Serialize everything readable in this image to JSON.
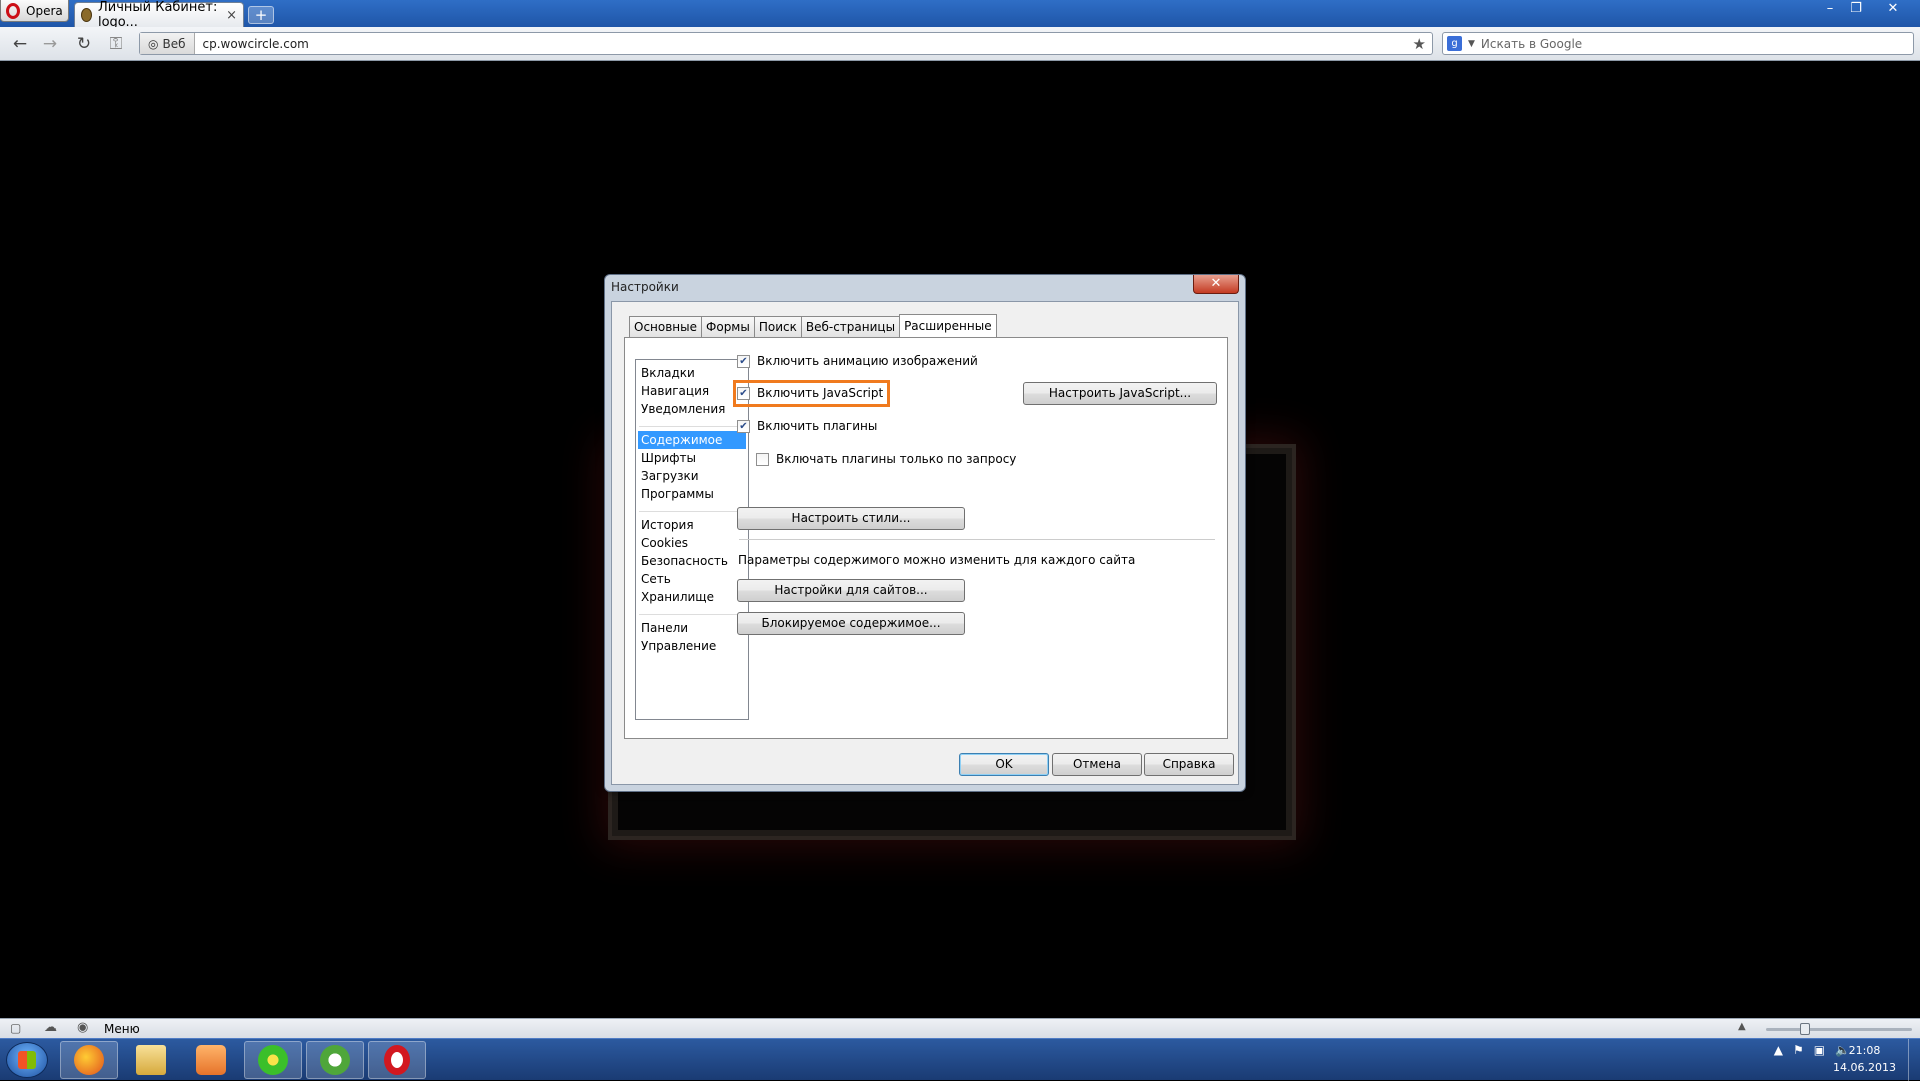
{
  "browser": {
    "menu_button": "Opera",
    "tab_title": "Личный Кабинет: logo...",
    "tab_close": "×",
    "new_tab": "+",
    "window_controls": [
      "–",
      "❐",
      "✕"
    ],
    "address_badge": "Веб",
    "address_url": "cp.wowcircle.com",
    "search_placeholder": "Искать в Google",
    "search_engine_letter": "g"
  },
  "dialog": {
    "title": "Настройки",
    "close": "✕",
    "tabs": [
      "Основные",
      "Формы",
      "Поиск",
      "Веб-страницы",
      "Расширенные"
    ],
    "active_tab": "Расширенные",
    "sidebar": {
      "group1": [
        "Вкладки",
        "Навигация",
        "Уведомления"
      ],
      "group2": [
        "Содержимое",
        "Шрифты",
        "Загрузки",
        "Программы"
      ],
      "group3": [
        "История",
        "Cookies",
        "Безопасность",
        "Сеть",
        "Хранилище"
      ],
      "group4": [
        "Панели",
        "Управление"
      ],
      "selected": "Содержимое"
    },
    "options": {
      "animation": {
        "label": "Включить анимацию изображений",
        "checked": true
      },
      "javascript": {
        "label": "Включить JavaScript",
        "checked": true
      },
      "plugins": {
        "label": "Включить плагины",
        "checked": true
      },
      "plugins_on_demand": {
        "label": "Включать плагины только по запросу",
        "checked": false
      }
    },
    "buttons": {
      "configure_js": "Настроить JavaScript...",
      "configure_styles": "Настроить стили...",
      "site_settings": "Настройки для сайтов...",
      "blocked_content": "Блокируемое содержимое...",
      "ok": "OK",
      "cancel": "Отмена",
      "help": "Справка"
    },
    "site_params_text": "Параметры содержимого можно изменить для каждого сайта"
  },
  "statusbar": {
    "menu_label": "Меню"
  },
  "taskbar": {
    "apps": [
      "firefox-icon",
      "folder-icon",
      "media-player-icon",
      "icq-icon",
      "utorrent-icon",
      "opera-icon"
    ],
    "clock_time": "21:08",
    "clock_date": "14.06.2013"
  },
  "colors": {
    "highlight": "#f07a1e",
    "selection": "#3399ff"
  }
}
